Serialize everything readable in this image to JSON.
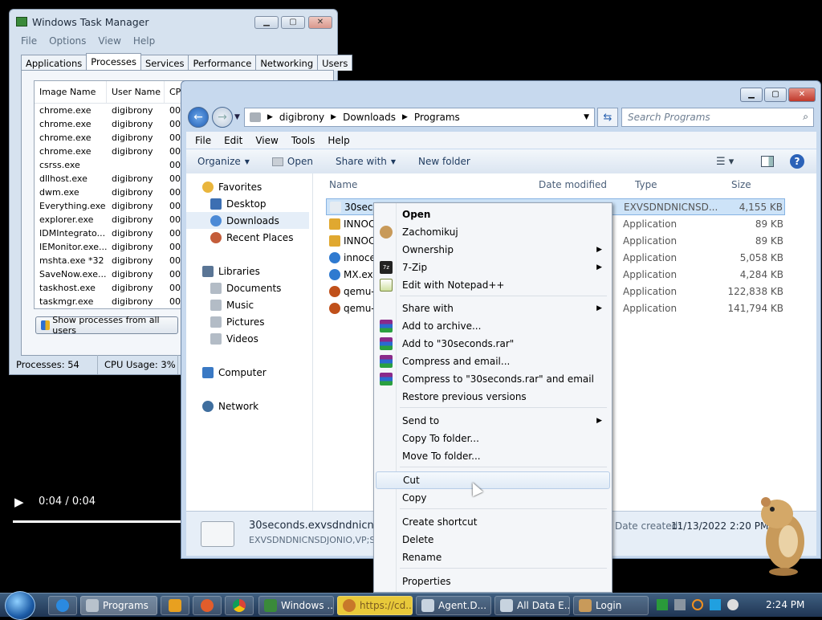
{
  "taskmgr": {
    "title": "Windows Task Manager",
    "menu": [
      "File",
      "Options",
      "View",
      "Help"
    ],
    "tabs": [
      "Applications",
      "Processes",
      "Services",
      "Performance",
      "Networking",
      "Users"
    ],
    "columns": [
      "Image Name",
      "User Name",
      "CPU"
    ],
    "rows": [
      [
        "chrome.exe",
        "digibrony",
        "00"
      ],
      [
        "chrome.exe",
        "digibrony",
        "00"
      ],
      [
        "chrome.exe",
        "digibrony",
        "00"
      ],
      [
        "chrome.exe",
        "digibrony",
        "00"
      ],
      [
        "csrss.exe",
        "",
        "00"
      ],
      [
        "dllhost.exe",
        "digibrony",
        "00"
      ],
      [
        "dwm.exe",
        "digibrony",
        "00"
      ],
      [
        "Everything.exe",
        "digibrony",
        "00"
      ],
      [
        "explorer.exe",
        "digibrony",
        "00"
      ],
      [
        "IDMIntegrato...",
        "digibrony",
        "00"
      ],
      [
        "IEMonitor.exe...",
        "digibrony",
        "00"
      ],
      [
        "mshta.exe *32",
        "digibrony",
        "00"
      ],
      [
        "SaveNow.exe...",
        "digibrony",
        "00"
      ],
      [
        "taskhost.exe",
        "digibrony",
        "00"
      ],
      [
        "taskmgr.exe",
        "digibrony",
        "00"
      ]
    ],
    "show_all_label": "Show processes from all users",
    "status_processes": "Processes: 54",
    "status_cpu": "CPU Usage: 3%"
  },
  "explorer": {
    "breadcrumb": [
      "digibrony",
      "Downloads",
      "Programs"
    ],
    "search_placeholder": "Search Programs",
    "menu": [
      "File",
      "Edit",
      "View",
      "Tools",
      "Help"
    ],
    "toolbar": {
      "organize": "Organize",
      "open": "Open",
      "share": "Share with",
      "new_folder": "New folder"
    },
    "nav": {
      "favorites": "Favorites",
      "fav_items": [
        "Desktop",
        "Downloads",
        "Recent Places"
      ],
      "libraries": "Libraries",
      "lib_items": [
        "Documents",
        "Music",
        "Pictures",
        "Videos"
      ],
      "computer": "Computer",
      "network": "Network"
    },
    "columns": {
      "name": "Name",
      "date": "Date modified",
      "type": "Type",
      "size": "Size"
    },
    "files": [
      {
        "name": "30seco",
        "date_frag": "M",
        "type": "EXVSDNDNICNSD...",
        "size": "4,155 KB"
      },
      {
        "name": "INNOC",
        "date_frag": "M",
        "type": "Application",
        "size": "89 KB"
      },
      {
        "name": "INNOC",
        "date_frag": "M",
        "type": "Application",
        "size": "89 KB"
      },
      {
        "name": "innoce",
        "date_frag": "M",
        "type": "Application",
        "size": "5,058 KB"
      },
      {
        "name": "MX.exe",
        "date_frag": "M",
        "type": "Application",
        "size": "4,284 KB"
      },
      {
        "name": "qemu-",
        "date_frag": "M",
        "type": "Application",
        "size": "122,838 KB"
      },
      {
        "name": "qemu-",
        "date_frag": "M",
        "type": "Application",
        "size": "141,794 KB"
      }
    ],
    "details": {
      "filename": "30seconds.exvsdndnicnsdjc",
      "filetype": "EXVSDNDNICNSDJONIO,VP;SI",
      "date_created_label": "Date created:",
      "date_created": "11/13/2022 2:20 PM"
    }
  },
  "context_menu": {
    "items": [
      {
        "label": "Open",
        "bold": true,
        "sub": false,
        "icon": ""
      },
      {
        "label": "Zachomikuj",
        "sub": false,
        "icon": "hamster-icon"
      },
      {
        "label": "Ownership",
        "sub": true,
        "icon": ""
      },
      {
        "label": "7-Zip",
        "sub": true,
        "icon": ""
      },
      {
        "label": "Edit with Notepad++",
        "sub": false,
        "icon": "notepad-icon"
      },
      {
        "label": "Share with",
        "sub": true,
        "icon": ""
      },
      {
        "label": "Add to archive...",
        "sub": false,
        "icon": "winrar-icon"
      },
      {
        "label": "Add to \"30seconds.rar\"",
        "sub": false,
        "icon": "winrar-icon"
      },
      {
        "label": "Compress and email...",
        "sub": false,
        "icon": "winrar-icon"
      },
      {
        "label": "Compress to \"30seconds.rar\" and email",
        "sub": false,
        "icon": "winrar-icon"
      },
      {
        "label": "Restore previous versions",
        "sub": false,
        "icon": ""
      },
      {
        "label": "Send to",
        "sub": true,
        "icon": ""
      },
      {
        "label": "Copy To folder...",
        "sub": false,
        "icon": ""
      },
      {
        "label": "Move To folder...",
        "sub": false,
        "icon": ""
      },
      {
        "label": "Cut",
        "sub": false,
        "icon": "",
        "highlight": true
      },
      {
        "label": "Copy",
        "sub": false,
        "icon": ""
      },
      {
        "label": "Create shortcut",
        "sub": false,
        "icon": ""
      },
      {
        "label": "Delete",
        "sub": false,
        "icon": ""
      },
      {
        "label": "Rename",
        "sub": false,
        "icon": ""
      },
      {
        "label": "Properties",
        "sub": false,
        "icon": ""
      }
    ]
  },
  "video": {
    "time": "0:04 / 0:04"
  },
  "taskbar": {
    "items": [
      "Programs",
      "Windows ...",
      "https://cd...",
      "Agent.D...",
      "All Data E...",
      "Login"
    ],
    "clock": "2:24 PM"
  }
}
